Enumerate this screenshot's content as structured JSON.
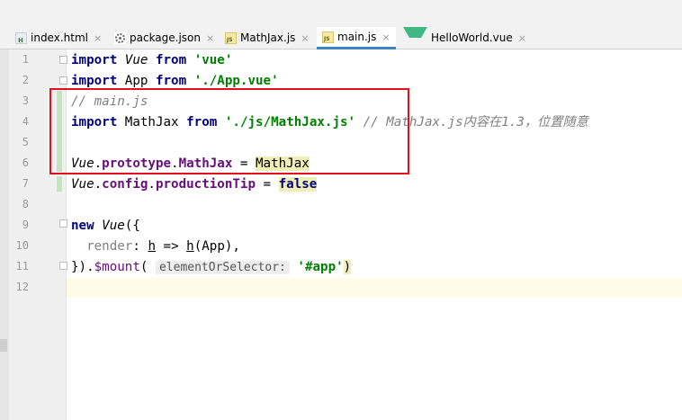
{
  "tabs": [
    {
      "label": "index.html",
      "icon": "html-file-icon",
      "active": false
    },
    {
      "label": "package.json",
      "icon": "json-file-icon",
      "active": false
    },
    {
      "label": "MathJax.js",
      "icon": "js-file-icon",
      "active": false
    },
    {
      "label": "main.js",
      "icon": "js-file-icon",
      "active": true
    },
    {
      "label": "HelloWorld.vue",
      "icon": "vue-file-icon",
      "active": false
    }
  ],
  "close_glyph": "×",
  "line_numbers": [
    "1",
    "2",
    "3",
    "4",
    "5",
    "6",
    "7",
    "8",
    "9",
    "10",
    "11",
    "12"
  ],
  "code": {
    "l1": {
      "kw": "import",
      "cls": "Vue",
      "kw2": "from",
      "str": "'vue'"
    },
    "l2": {
      "kw": "import",
      "name": "App",
      "kw2": "from",
      "str": "'./App.vue'"
    },
    "l3": {
      "cmt": "// main.js"
    },
    "l4": {
      "kw": "import",
      "name": "MathJax",
      "kw2": "from",
      "str": "'./js/MathJax.js'",
      "cmt": "// MathJax.js内容在1.3，位置随意"
    },
    "l6": {
      "cls": "Vue",
      "p1": "prototype",
      "p2": "MathJax",
      "op": " = ",
      "val": "MathJax"
    },
    "l7": {
      "cls": "Vue",
      "p1": "config",
      "p2": "productionTip",
      "op": " = ",
      "kw": "false"
    },
    "l9": {
      "kw": "new",
      "cls": "Vue",
      "punct": "({"
    },
    "l10": {
      "param": "render",
      "rest1": ": ",
      "h1": "h",
      "arrow": " => ",
      "h2": "h",
      "rest2": "(App),"
    },
    "l11": {
      "punct": "}).",
      "method": "$mount",
      "open": "(",
      "hint": "elementOrSelector:",
      "str": "'#app'",
      "close": ")"
    }
  },
  "colors": {
    "highlight_box": "#e2121c",
    "active_tab_underline": "#4083c9",
    "string": "#008000",
    "keyword": "#000080"
  }
}
